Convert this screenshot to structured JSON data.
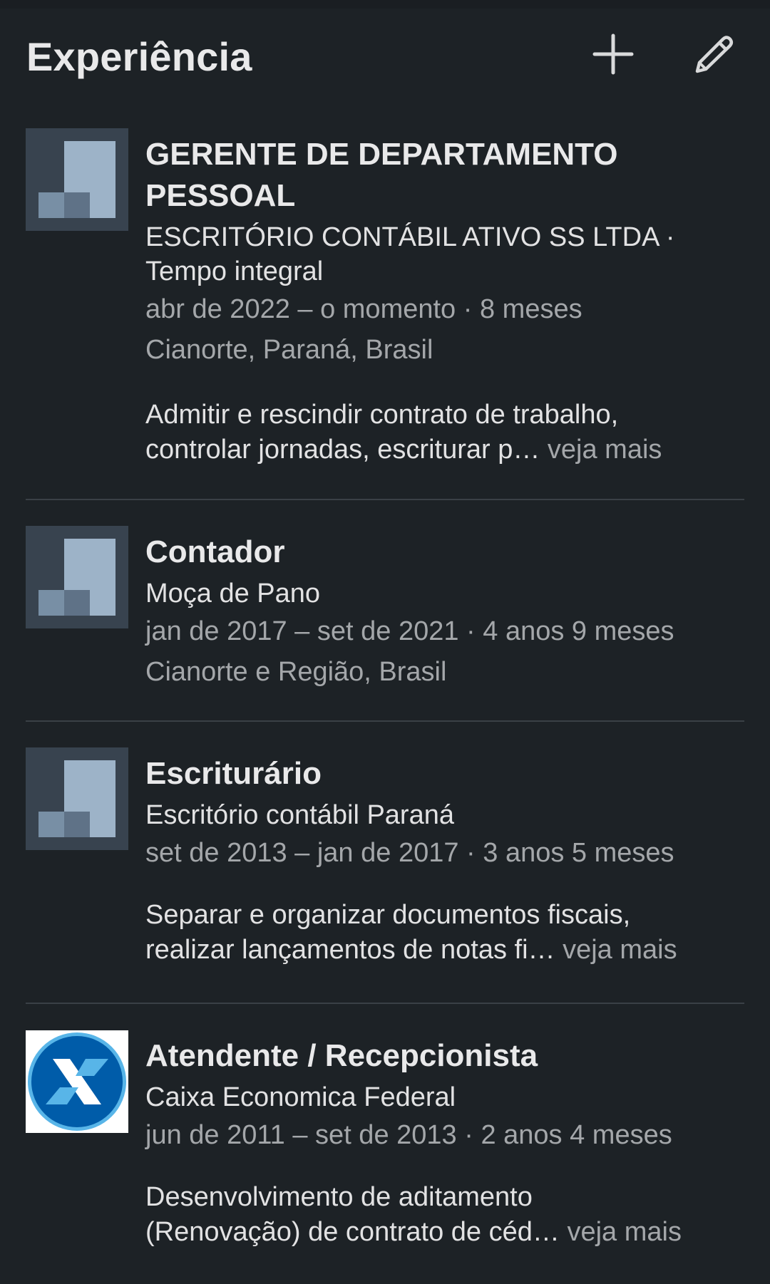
{
  "section": {
    "title": "Experiência",
    "add_icon": "plus-icon",
    "edit_icon": "pencil-icon"
  },
  "colors": {
    "background": "#1d2226",
    "divider": "#3a4046",
    "caixa_blue": "#005ca9",
    "caixa_light": "#58b5e8"
  },
  "experiences": [
    {
      "title_line1": "GERENTE DE DEPARTAMENTO",
      "title_line2": "PESSOAL",
      "company": "ESCRITÓRIO CONTÁBIL ATIVO SS LTDA",
      "employment_type": "Tempo integral",
      "dates": "abr de 2022 – o momento",
      "duration": "8 meses",
      "location": "Cianorte, Paraná, Brasil",
      "desc_line1": "Admitir e rescindir contrato de trabalho,",
      "desc_line2": "controlar jornadas, escriturar p…",
      "see_more": "veja mais",
      "logo": "company-placeholder-icon"
    },
    {
      "title": "Contador",
      "company": "Moça de Pano",
      "dates": "jan de 2017 – set de 2021",
      "duration": "4 anos 9 meses",
      "location": "Cianorte e Região, Brasil",
      "logo": "company-placeholder-icon"
    },
    {
      "title": "Escriturário",
      "company": "Escritório contábil Paraná",
      "dates": "set de 2013 – jan de 2017",
      "duration": "3 anos 5 meses",
      "desc_line1": "Separar e organizar documentos fiscais,",
      "desc_line2": "realizar lançamentos de notas fi…",
      "see_more": "veja mais",
      "logo": "company-placeholder-icon"
    },
    {
      "title": "Atendente / Recepcionista",
      "company": "Caixa Economica Federal",
      "dates": "jun de 2011 – set de 2013",
      "duration": "2 anos 4 meses",
      "desc_line1": "Desenvolvimento de aditamento",
      "desc_line2": "(Renovação) de contrato de céd…",
      "see_more": "veja mais",
      "logo": "caixa-logo-icon"
    }
  ],
  "separator": " · "
}
